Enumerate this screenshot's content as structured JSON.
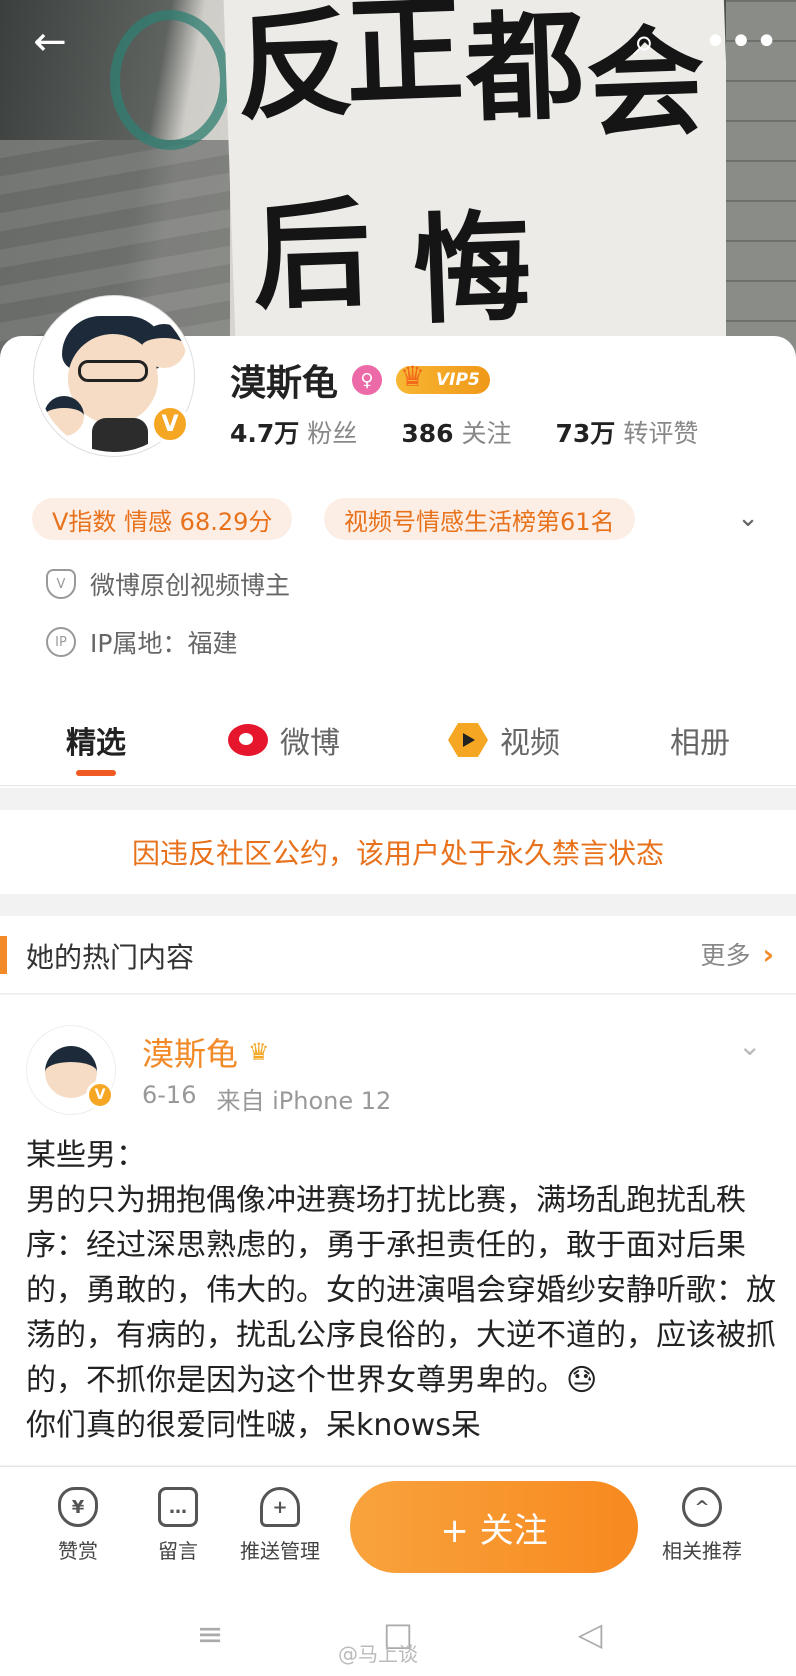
{
  "cover": {
    "poster_glyphs": [
      "反",
      "正",
      "都",
      "会",
      "后",
      "悔"
    ]
  },
  "topbar": {
    "back_icon": "←",
    "search_icon": "⌕",
    "more_icon": "•••"
  },
  "profile": {
    "name": "漠斯龟",
    "gender_symbol": "♀",
    "vip_label": "VIP5",
    "verify_mark": "V",
    "stats": [
      {
        "value": "4.7万",
        "label": "粉丝"
      },
      {
        "value": "386",
        "label": "关注"
      },
      {
        "value": "73万",
        "label": "转评赞"
      }
    ],
    "tags": [
      "V指数 情感 68.29分",
      "视频号情感生活榜第61名"
    ],
    "expand_icon": "⌄",
    "info": [
      {
        "icon": "V",
        "text": "微博原创视频博主"
      },
      {
        "icon": "IP",
        "text": "IP属地：福建"
      }
    ]
  },
  "tabs": [
    {
      "label": "精选"
    },
    {
      "label": "微博"
    },
    {
      "label": "视频"
    },
    {
      "label": "相册"
    }
  ],
  "notice": "因违反社区公约，该用户处于永久禁言状态",
  "hot_section": {
    "title": "她的热门内容",
    "more_label": "更多",
    "more_icon": "›"
  },
  "post": {
    "author": "漠斯龟",
    "date": "6-16",
    "source": "来自 iPhone 12",
    "menu_icon": "⌄",
    "text": "某些男：\n男的只为拥抱偶像冲进赛场打扰比赛，满场乱跑扰乱秩序：经过深思熟虑的，勇于承担责任的，敢于面对后果的，勇敢的，伟大的。女的进演唱会穿婚纱安静听歌：放荡的，有病的，扰乱公序良俗的，大逆不道的，应该被抓的，不抓你是因为这个世界女尊男卑的。😓\n你们真的很爱同性啵，呆knows呆"
  },
  "bottom_bar": {
    "items": [
      {
        "icon": "¥",
        "label": "赞赏"
      },
      {
        "icon": "…",
        "label": "留言"
      },
      {
        "icon": "+",
        "label": "推送管理"
      },
      {
        "icon": "^",
        "label": "相关推荐"
      }
    ],
    "follow_label": "+ 关注"
  },
  "system_nav": {
    "menu_icon": "≡",
    "home_icon": "□",
    "back_icon": "◁"
  },
  "watermark": "@马上谈"
}
